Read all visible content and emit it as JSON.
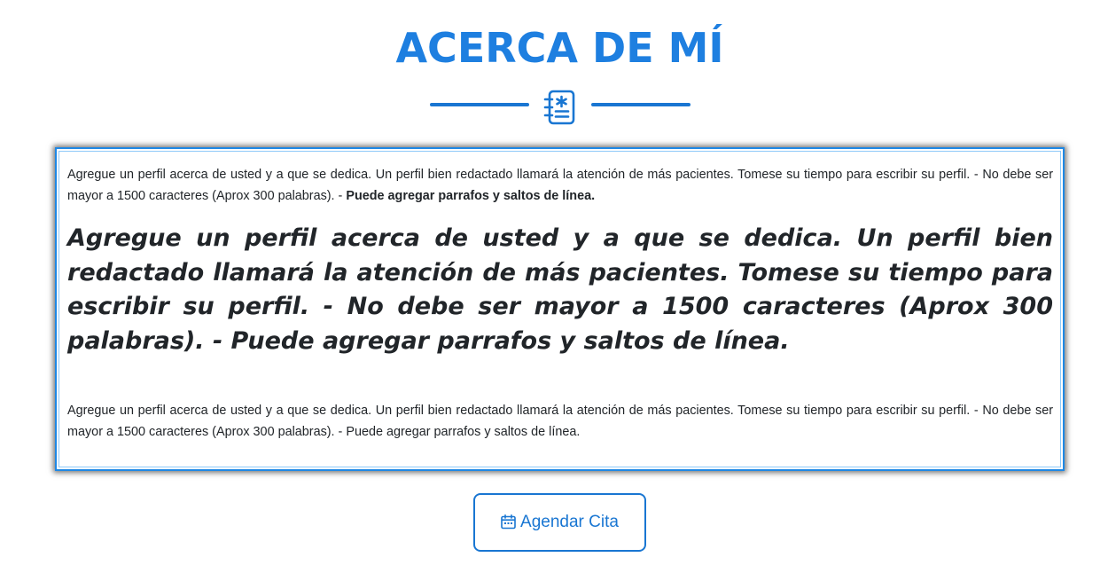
{
  "section": {
    "title": "ACERCA DE MÍ",
    "divider_icon": "contact-book-icon"
  },
  "about": {
    "intro": "Agregue un perfil acerca de usted y a que se dedica. Un perfil bien redactado llamará la atención de más pacientes. Tomese su tiempo para escribir su perfil. - No debe ser mayor a 1500 caracteres (Aprox 300 palabras). - ",
    "intro_bold": "Puede agregar parrafos y saltos de línea.",
    "heading": "Agregue un perfil acerca de usted y a que se dedica. Un perfil bien redactado llamará la atención de más pacientes. Tomese su tiempo para escribir su perfil. - No debe ser mayor a 1500 caracteres (Aprox 300 palabras). - Puede agregar parrafos y saltos de línea.",
    "body": "Agregue un perfil acerca de usted y a que se dedica. Un perfil bien redactado llamará la atención de más pacientes. Tomese su tiempo para escribir su perfil. - No debe ser mayor a 1500 caracteres (Aprox 300 palabras). - Puede agregar parrafos y saltos de línea."
  },
  "cta": {
    "label": "Agendar Cita",
    "icon": "calendar-icon"
  },
  "colors": {
    "accent": "#1976d2",
    "title": "#1e7fe0",
    "text": "#212529"
  }
}
